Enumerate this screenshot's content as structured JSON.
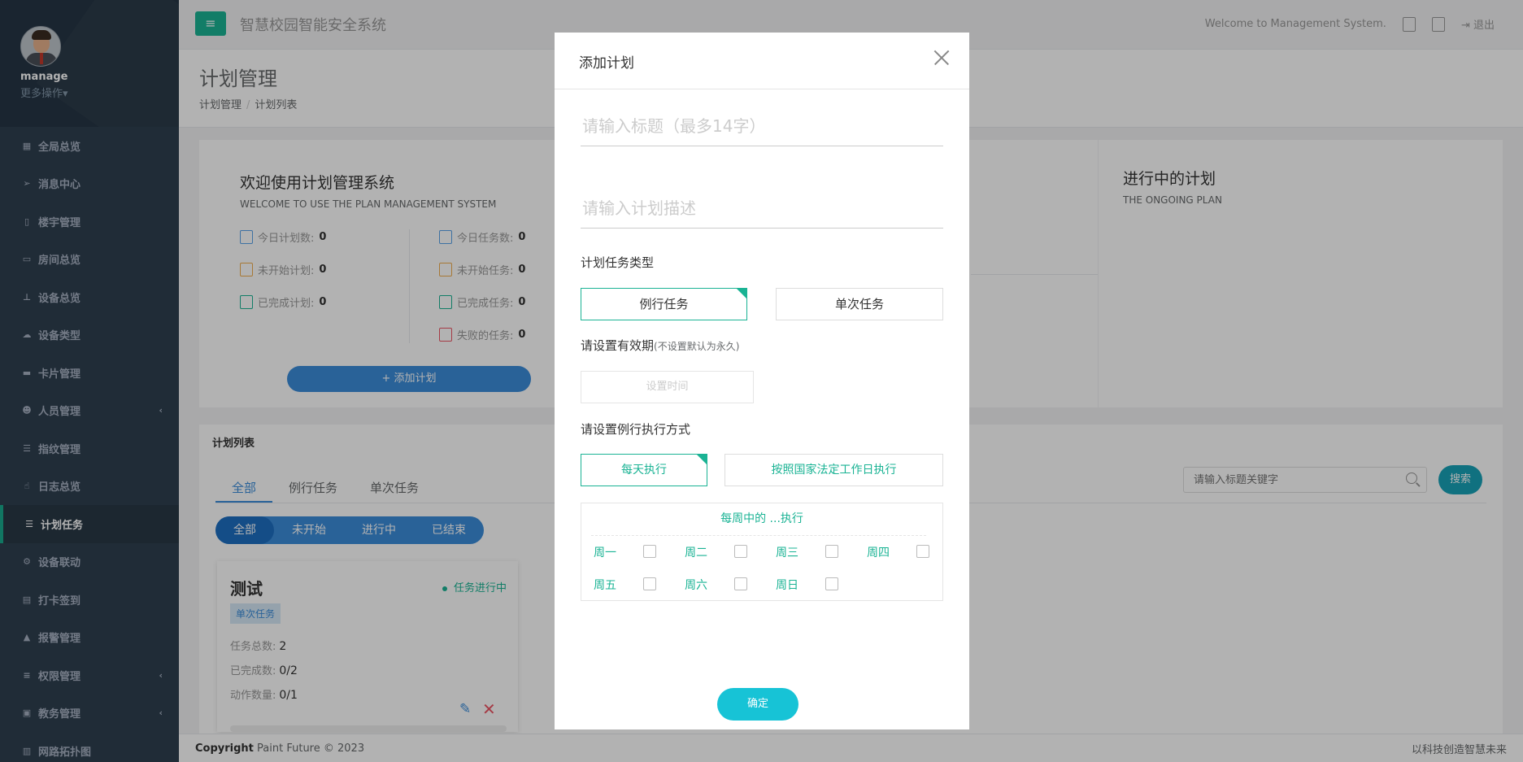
{
  "app": {
    "title": "智慧校园智能安全系统",
    "welcome": "Welcome to Management System.",
    "logout": "退出"
  },
  "user": {
    "name": "manage",
    "more": "更多操作▾"
  },
  "sidebar": {
    "items": [
      {
        "label": "全局总览",
        "icon": "dashboard-icon"
      },
      {
        "label": "消息中心",
        "icon": "paper-plane-icon"
      },
      {
        "label": "楼宇管理",
        "icon": "building-icon"
      },
      {
        "label": "房间总览",
        "icon": "monitor-icon"
      },
      {
        "label": "设备总览",
        "icon": "sitemap-icon"
      },
      {
        "label": "设备类型",
        "icon": "cloud-icon"
      },
      {
        "label": "卡片管理",
        "icon": "credit-card-icon"
      },
      {
        "label": "人员管理",
        "icon": "users-icon"
      },
      {
        "label": "指纹管理",
        "icon": "bars-icon"
      },
      {
        "label": "日志总览",
        "icon": "hand-icon"
      },
      {
        "label": "计划任务",
        "icon": "list-icon"
      },
      {
        "label": "设备联动",
        "icon": "cogs-icon"
      },
      {
        "label": "打卡签到",
        "icon": "id-card-icon"
      },
      {
        "label": "报警管理",
        "icon": "warning-icon"
      },
      {
        "label": "权限管理",
        "icon": "sliders-icon"
      },
      {
        "label": "教务管理",
        "icon": "cubes-icon"
      },
      {
        "label": "网路拓扑图",
        "icon": "network-icon"
      }
    ]
  },
  "page": {
    "title": "计划管理",
    "breadcrumb": [
      "计划管理",
      "计划列表"
    ]
  },
  "welcome_panel": {
    "heading": "欢迎使用计划管理系统",
    "subheading": "WELCOME TO USE THE PLAN MANAGEMENT SYSTEM",
    "stats_left": [
      {
        "label": "今日计划数:",
        "value": "0"
      },
      {
        "label": "未开始计划:",
        "value": "0"
      },
      {
        "label": "已完成计划:",
        "value": "0"
      }
    ],
    "stats_right": [
      {
        "label": "今日任务数:",
        "value": "0"
      },
      {
        "label": "未开始任务:",
        "value": "0"
      },
      {
        "label": "已完成任务:",
        "value": "0"
      },
      {
        "label": "失败的任务:",
        "value": "0"
      }
    ],
    "add_button": "+ 添加计划"
  },
  "ongoing_panel": {
    "heading": "进行中的计划",
    "subheading": "THE ONGOING PLAN"
  },
  "plan_list": {
    "title": "计划列表",
    "tabs": [
      "全部",
      "例行任务",
      "单次任务"
    ],
    "filters": [
      "全部",
      "未开始",
      "进行中",
      "已结束"
    ],
    "search_placeholder": "请输入标题关键字",
    "search_button": "搜索",
    "card": {
      "title": "测试",
      "status": "任务进行中",
      "type": "单次任务",
      "rows": [
        {
          "label": "任务总数:",
          "value": "2"
        },
        {
          "label": "已完成数:",
          "value": "0/2"
        },
        {
          "label": "动作数量:",
          "value": "0/1"
        }
      ]
    }
  },
  "footer": {
    "copyright_bold": "Copyright",
    "copyright_rest": " Paint Future © 2023",
    "slogan": "以科技创造智慧未来"
  },
  "modal": {
    "title": "添加计划",
    "title_placeholder": "请输入标题（最多14字）",
    "desc_placeholder": "请输入计划描述",
    "type_label": "计划任务类型",
    "type_options": [
      "例行任务",
      "单次任务"
    ],
    "validity_label": "请设置有效期",
    "validity_hint": "(不设置默认为永久)",
    "time_placeholder": "设置时间",
    "exec_label": "请设置例行执行方式",
    "exec_options": [
      "每天执行",
      "按照国家法定工作日执行"
    ],
    "week_title": "每周中的 ...执行",
    "days": [
      "周一",
      "周二",
      "周三",
      "周四",
      "周五",
      "周六",
      "周日"
    ],
    "confirm": "确定"
  },
  "colors": {
    "sidebar": "#2f4050",
    "accent": "#1ab394",
    "primary": "#3c8dda",
    "danger": "#ed5565"
  }
}
